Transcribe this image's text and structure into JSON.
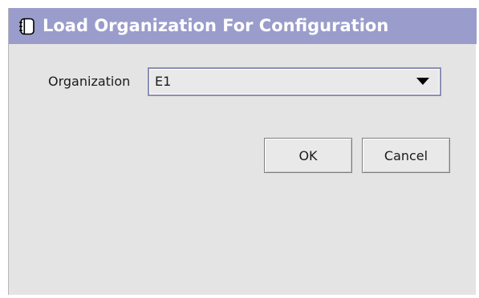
{
  "dialog": {
    "title": "Load Organization For Configuration",
    "title_icon": "notebook-icon"
  },
  "form": {
    "organization_label": "Organization",
    "organization_value": "E1"
  },
  "buttons": {
    "ok_label": "OK",
    "cancel_label": "Cancel"
  },
  "colors": {
    "titlebar": "#9a9ccb",
    "dialog_background": "#e4e4e4",
    "select_border": "#8a8fb4"
  }
}
